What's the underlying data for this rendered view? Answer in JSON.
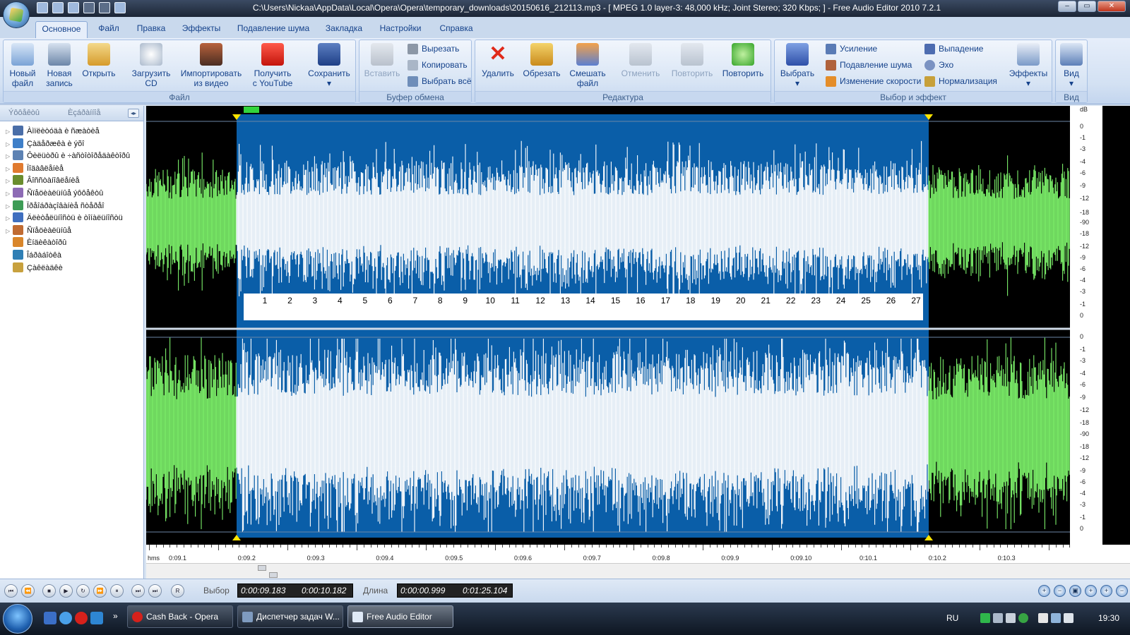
{
  "window": {
    "title": "C:\\Users\\Nickaa\\AppData\\Local\\Opera\\Opera\\temporary_downloads\\20150616_212113.mp3 - [ MPEG 1.0 layer-3: 48,000 kHz; Joint Stereo; 320 Kbps;  ] - Free Audio Editor 2010 7.2.1",
    "min_icon": "minimize-icon",
    "max_icon": "maximize-icon",
    "close_icon": "close-icon",
    "min_glyph": "–",
    "max_glyph": "▭",
    "close_glyph": "✕"
  },
  "tabs": [
    "Основное",
    "Файл",
    "Правка",
    "Эффекты",
    "Подавление шума",
    "Закладка",
    "Настройки",
    "Справка"
  ],
  "ribbon": {
    "file_group": {
      "label": "Файл",
      "new_file": [
        "Новый",
        "файл"
      ],
      "new_record": [
        "Новая",
        "запись"
      ],
      "open": [
        "Открыть",
        ""
      ],
      "load_cd": [
        "Загрузить",
        "CD"
      ],
      "import_video": [
        "Импортировать",
        "из видео"
      ],
      "youtube": [
        "Получить",
        "с YouTube"
      ],
      "save": [
        "Сохранить",
        "▾"
      ]
    },
    "clipboard_group": {
      "label": "Буфер обмена",
      "paste": "Вставить",
      "cut": "Вырезать",
      "copy": "Копировать",
      "select_all": "Выбрать всё"
    },
    "edit_group": {
      "label": "Редактура",
      "delete": "Удалить",
      "trim": "Обрезать",
      "mix": [
        "Смешать",
        "файл"
      ],
      "undo": "Отменить",
      "redo": "Повторить",
      "repeat": "Повторить"
    },
    "select_effect_group": {
      "label": "Выбор и эффект",
      "select": [
        "Выбрать",
        "▾"
      ],
      "amplify": "Усиление",
      "noise_reduction": "Подавление шума",
      "speed_change": "Изменение скорости",
      "fade": "Выпадение",
      "echo": "Эхо",
      "normalize": "Нормализация",
      "effects": [
        "Эффекты",
        "▾"
      ]
    },
    "view_group": {
      "label": "Вид",
      "view": [
        "Вид",
        "▾"
      ]
    }
  },
  "left_panel": {
    "tab1": "Ýôôåêòû",
    "tab2": "Èçáðàííîå",
    "collapse_glyph": "◂▸",
    "tree": [
      "Àìïëèòóäà è ñæàòèå",
      "Çàäåðæêà è ýõî",
      "Ôèëüòðû è ÷àñòîòîðåäàêòîðû",
      "Ïîäàâëåíèå",
      "Âîññòàíîâëåíèå",
      "Ñïåöèàëüíûå ýôôåêòû",
      "Ïðåîáðàçîâàíèå ñòåðåî",
      "Äëèòåëüíîñòü è òîíàëüíîñòü",
      "Ñïåöèàëüíûå",
      "Èíäèêàòîðû",
      "Îáðàáîòêà",
      "Çàêëàäêè"
    ]
  },
  "waveform": {
    "colors": {
      "background": "#000000",
      "wave_unselected": "#7cf06a",
      "selection_bg": "#0a5ea8",
      "wave_selected": "#ffffff"
    },
    "markers": [
      "1",
      "2",
      "3",
      "4",
      "5",
      "6",
      "7",
      "8",
      "9",
      "10",
      "11",
      "12",
      "13",
      "14",
      "15",
      "16",
      "17",
      "18",
      "19",
      "20",
      "21",
      "22",
      "23",
      "24",
      "25",
      "26",
      "27"
    ],
    "db_unit": "dB",
    "db_labels_top": [
      "0",
      "-1",
      "-3",
      "-4",
      "-6",
      "-9",
      "-12",
      "-18",
      "-90",
      "-18",
      "-12",
      "-9",
      "-6",
      "-4",
      "-3",
      "-1",
      "0"
    ],
    "db_labels_bottom": [
      "0",
      "-1",
      "-3",
      "-4",
      "-6",
      "-9",
      "-12",
      "-18",
      "-90",
      "-18",
      "-12",
      "-9",
      "-6",
      "-4",
      "-3",
      "-1",
      "0"
    ],
    "time_unit": "hms",
    "time_labels": [
      "0:09.1",
      "0:09.2",
      "0:09.3",
      "0:09.4",
      "0:09.5",
      "0:09.6",
      "0:09.7",
      "0:09.8",
      "0:09.9",
      "0:09.10",
      "0:10.1",
      "0:10.2",
      "0:10.3"
    ]
  },
  "status": {
    "selection_label": "Выбор",
    "selection_start": "0:00:09.183",
    "selection_end": "0:00:10.182",
    "length_label": "Длина",
    "length_selected": "0:00:00.999",
    "length_total": "0:01:25.104",
    "transport": [
      "⏮",
      "⏪",
      "■",
      "▶",
      "↻",
      "⏩",
      "⏸",
      "⏭",
      "⏭"
    ],
    "record_glyph": "R",
    "zoom": [
      "+",
      "−",
      "▣",
      "+",
      "+",
      "−"
    ]
  },
  "taskbar": {
    "tasks": [
      "Cash Back - Opera",
      "Диспетчер задач W...",
      "Free Audio Editor"
    ],
    "lang": "RU",
    "clock": "19:30",
    "more_glyph": "»"
  }
}
